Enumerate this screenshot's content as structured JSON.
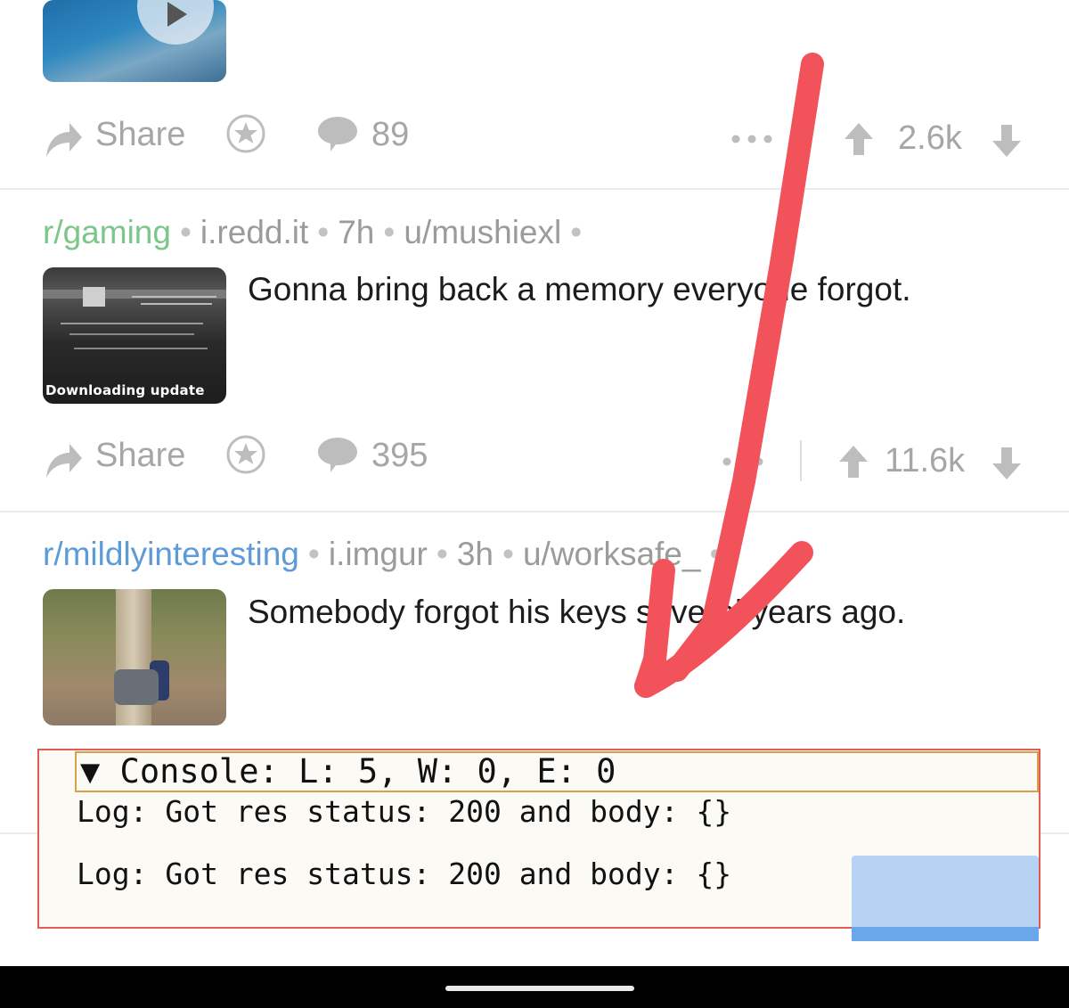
{
  "posts": [
    {
      "actions": {
        "share_label": "Share",
        "comments": "89",
        "score": "2.6k"
      }
    },
    {
      "subreddit": "r/gaming",
      "domain": "i.redd.it",
      "age": "7h",
      "author": "u/mushiexl",
      "title": "Gonna bring back a memory everyone forgot.",
      "thumb_caption": "Downloading update",
      "actions": {
        "share_label": "Share",
        "comments": "395",
        "score": "11.6k"
      }
    },
    {
      "subreddit": "r/mildlyinteresting",
      "domain": "i.imgur",
      "age": "3h",
      "author": "u/worksafe_",
      "title": "Somebody forgot his keys several years ago."
    }
  ],
  "console": {
    "header": "▼ Console: L: 5, W: 0, E: 0",
    "logs": [
      "Log: Got res status: 200 and body: {}",
      "Log: Got res status: 200 and body: {}"
    ]
  },
  "colors": {
    "subreddit_green": "#7cc68a",
    "subreddit_blue": "#5c9bd8",
    "annotation_arrow": "#f2525a",
    "console_border": "#e35c53",
    "console_header_border": "#d6a14a"
  },
  "icons": [
    "share-icon",
    "award-icon",
    "comment-icon",
    "more-icon",
    "upvote-icon",
    "downvote-icon",
    "play-icon"
  ]
}
